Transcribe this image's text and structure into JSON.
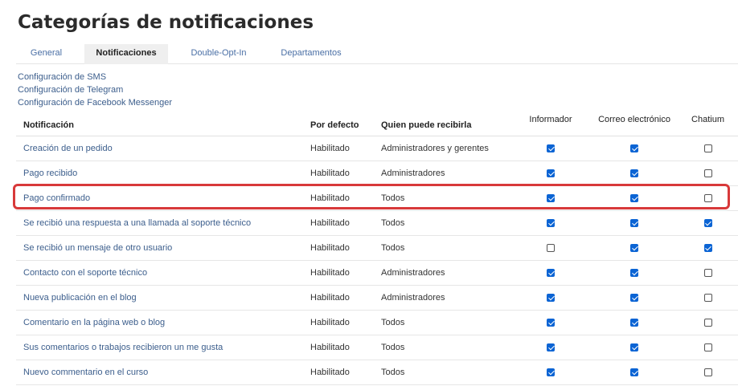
{
  "page": {
    "title": "Categorías de notificaciones"
  },
  "tabs": [
    {
      "label": "General",
      "active": false
    },
    {
      "label": "Notificaciones",
      "active": true
    },
    {
      "label": "Double-Opt-In",
      "active": false
    },
    {
      "label": "Departamentos",
      "active": false
    }
  ],
  "links": [
    "Configuración de SMS",
    "Configuración de Telegram",
    "Configuración de Facebook Messenger"
  ],
  "table": {
    "headers": {
      "notification": "Notificación",
      "default": "Por defecto",
      "recipients": "Quien puede recibirla",
      "informer": "Informador",
      "email": "Correo electrónico",
      "chatium": "Chatium"
    },
    "rows": [
      {
        "name": "Creación de un pedido",
        "default": "Habilitado",
        "recipients": "Administradores y gerentes",
        "informer": true,
        "email": true,
        "chatium": false
      },
      {
        "name": "Pago recibido",
        "default": "Habilitado",
        "recipients": "Administradores",
        "informer": true,
        "email": true,
        "chatium": false
      },
      {
        "name": "Pago confirmado",
        "default": "Habilitado",
        "recipients": "Todos",
        "informer": true,
        "email": true,
        "chatium": false,
        "highlighted": true
      },
      {
        "name": "Se recibió una respuesta a una llamada al soporte técnico",
        "default": "Habilitado",
        "recipients": "Todos",
        "informer": true,
        "email": true,
        "chatium": true
      },
      {
        "name": "Se recibió un mensaje de otro usuario",
        "default": "Habilitado",
        "recipients": "Todos",
        "informer": false,
        "email": true,
        "chatium": true
      },
      {
        "name": "Contacto con el soporte técnico",
        "default": "Habilitado",
        "recipients": "Administradores",
        "informer": true,
        "email": true,
        "chatium": false
      },
      {
        "name": "Nueva publicación en el blog",
        "default": "Habilitado",
        "recipients": "Administradores",
        "informer": true,
        "email": true,
        "chatium": false
      },
      {
        "name": "Comentario en la página web o blog",
        "default": "Habilitado",
        "recipients": "Todos",
        "informer": true,
        "email": true,
        "chatium": false
      },
      {
        "name": "Sus comentarios o trabajos recibieron un me gusta",
        "default": "Habilitado",
        "recipients": "Todos",
        "informer": true,
        "email": true,
        "chatium": false
      },
      {
        "name": "Nuevo commentario en el curso",
        "default": "Habilitado",
        "recipients": "Todos",
        "informer": true,
        "email": true,
        "chatium": false
      }
    ]
  },
  "colors": {
    "accent": "#0b64d4",
    "link": "#3c5e8c",
    "highlight": "#d8393a"
  }
}
